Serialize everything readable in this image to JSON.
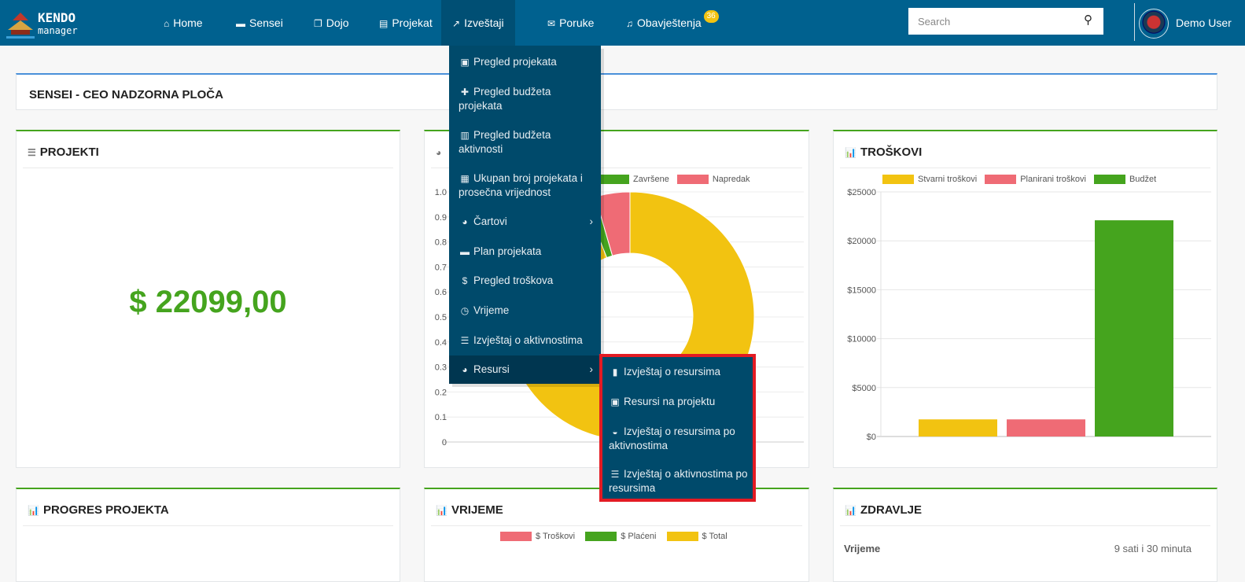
{
  "nav": {
    "logo_text": "KENDO manager",
    "items": [
      {
        "label": "Home",
        "icon": "home-icon",
        "glyph": "⌂"
      },
      {
        "label": "Sensei",
        "icon": "briefcase-icon",
        "glyph": "▬"
      },
      {
        "label": "Dojo",
        "icon": "copy-icon",
        "glyph": "❐"
      },
      {
        "label": "Projekat",
        "icon": "file-icon",
        "glyph": "▤"
      },
      {
        "label": "Izveštaji",
        "icon": "line-chart-icon",
        "glyph": "↗",
        "active": true
      },
      {
        "label": "Poruke",
        "icon": "envelope-icon",
        "glyph": "✉"
      },
      {
        "label": "Obavještenja",
        "icon": "bell-icon",
        "glyph": "♫",
        "badge": "36"
      }
    ],
    "search_placeholder": "Search",
    "user": "Demo User"
  },
  "page_title": "SENSEI - CEO NADZORNA PLOČA",
  "projekti": {
    "title": "PROJEKTI",
    "value": "$ 22099,00"
  },
  "menu": {
    "items": [
      {
        "label": "Pregled projekata",
        "glyph": "▣"
      },
      {
        "label": "Pregled budžeta projekata",
        "glyph": "✚"
      },
      {
        "label": "Pregled budžeta aktivnosti",
        "glyph": "▥"
      },
      {
        "label": "Ukupan broj projekata i prosečna vrijednost",
        "glyph": "▦"
      },
      {
        "label": "Čartovi",
        "glyph": "◕",
        "submenu": true
      },
      {
        "label": "Plan projekata",
        "glyph": "▬"
      },
      {
        "label": "Pregled troškova",
        "glyph": "$"
      },
      {
        "label": "Vrijeme",
        "glyph": "◷"
      },
      {
        "label": "Izvještaj o aktivnostima",
        "glyph": "☰"
      },
      {
        "label": "Resursi",
        "glyph": "◕",
        "submenu": true,
        "selected": true
      }
    ],
    "submenu": [
      {
        "label": "Izvještaj o resursima",
        "glyph": "▮"
      },
      {
        "label": "Resursi na projektu",
        "glyph": "▣"
      },
      {
        "label": "Izvještaj o resursima po aktivnostima",
        "glyph": "◒"
      },
      {
        "label": "Izvještaj o aktivnostima po resursima",
        "glyph": "☰"
      }
    ]
  },
  "chart_data": [
    {
      "type": "pie",
      "legend": [
        "Završene",
        "Napredak"
      ],
      "yticks": [
        "1.0",
        "0.9",
        "0.8",
        "0.7",
        "0.6",
        "0.5",
        "0.4",
        "0.3",
        "0.2",
        "0.1",
        "0"
      ],
      "slices": [
        {
          "value": 0.94,
          "color": "#f2c311"
        },
        {
          "name": "Završene",
          "value": 0.015,
          "color": "#45a41e"
        },
        {
          "name": "Napredak",
          "value": 0.045,
          "color": "#ef6b75"
        }
      ]
    },
    {
      "type": "bar",
      "title": "TROŠKOVI",
      "series": [
        {
          "name": "Stvarni troškovi",
          "value": 1750,
          "color": "#f2c311"
        },
        {
          "name": "Planirani troškovi",
          "value": 1750,
          "color": "#ef6b75"
        },
        {
          "name": "Budžet",
          "value": 22099,
          "color": "#45a41e"
        }
      ],
      "yticks": [
        "$25000",
        "$20000",
        "$15000",
        "$10000",
        "$5000",
        "$0"
      ],
      "ylim": [
        0,
        25000
      ]
    },
    {
      "type": "bar",
      "title": "VRIJEME",
      "legend": [
        {
          "name": "$ Troškovi",
          "color": "#ef6b75"
        },
        {
          "name": "$ Plaćeni",
          "color": "#45a41e"
        },
        {
          "name": "$ Total",
          "color": "#f2c311"
        }
      ]
    }
  ],
  "progres": {
    "title": "PROGRES PROJEKTA"
  },
  "zdravlje": {
    "title": "ZDRAVLJE",
    "rows": [
      {
        "label": "Vrijeme",
        "value": "9 sati i 30 minuta"
      }
    ]
  }
}
